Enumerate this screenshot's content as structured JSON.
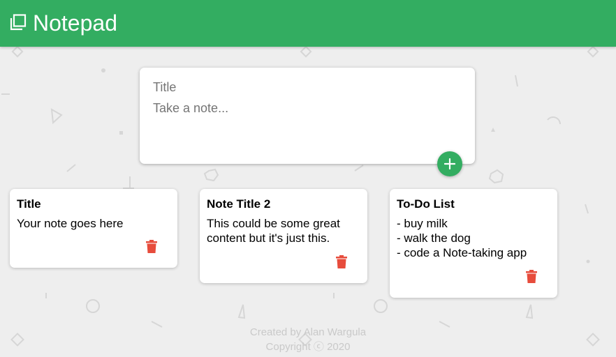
{
  "header": {
    "title": "Notepad",
    "icon": "notes-icon",
    "background_color": "#33ad61"
  },
  "composer": {
    "title_placeholder": "Title",
    "content_placeholder": "Take a note...",
    "title_value": "",
    "content_value": "",
    "add_icon": "plus-icon"
  },
  "notes": [
    {
      "title": "Title",
      "content": "Your note goes here",
      "delete_icon": "trash-icon"
    },
    {
      "title": "Note Title 2",
      "content": "This could be some great content but it's just this.",
      "delete_icon": "trash-icon"
    },
    {
      "title": "To-Do List",
      "content": "- buy milk\n- walk the dog\n- code a Note-taking app",
      "delete_icon": "trash-icon"
    }
  ],
  "footer": {
    "line1": "Created by Alan Wargula",
    "line2": "Copyright ⓒ 2020"
  },
  "colors": {
    "accent": "#33ad61",
    "delete": "#e74c3c",
    "background": "#eeeeee"
  }
}
